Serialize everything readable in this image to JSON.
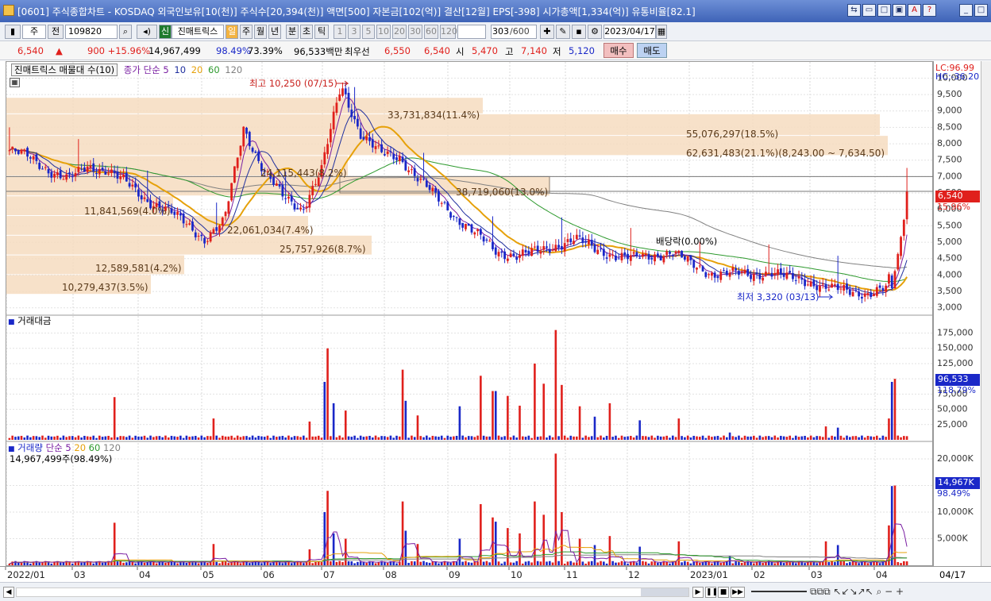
{
  "title_bar": {
    "text": "[0601] 주식종합차트 - KOSDAQ 외국인보유[10(천)] 주식수[20,394(천)] 액면[500] 자본금[102(억)] 결산[12월] EPS[-398] 시가총액[1,334(억)] 유통비율[82.1]"
  },
  "toolbar": {
    "market_select": "주",
    "prev_label": "전",
    "code": "109820",
    "source_label": "신",
    "source_name": "진매트릭스",
    "periods": [
      "일",
      "주",
      "월",
      "년",
      "분",
      "초",
      "틱"
    ],
    "intervals": [
      "1",
      "3",
      "5",
      "10",
      "20",
      "30",
      "60",
      "120"
    ],
    "count": "303",
    "count_total": "/600",
    "date": "2023/04/17"
  },
  "quote": {
    "price": "6,540",
    "change": "900 +15.96%",
    "volume": "14,967,499",
    "vol_ratio": "98.49%",
    "turnover": "73.39%",
    "amount": "96,533백만",
    "pref_label": "최우선",
    "ask": "6,550",
    "bid": "6,540",
    "open_label": "시",
    "open": "5,470",
    "high_label": "고",
    "high": "7,140",
    "low_label": "저",
    "low": "5,120",
    "buy_label": "매수",
    "sell_label": "매도"
  },
  "price_panel": {
    "legend_name": "진매트릭스 매물대 수(10)",
    "ma_label": "종가 단순 5",
    "ma_periods": [
      "10",
      "20",
      "60",
      "120"
    ],
    "lc_label": "LC:96.99",
    "hc_label": "HC:-36.20",
    "high_note": "최고 10,250 (07/15)",
    "low_note": "최저 3,320 (03/13)",
    "dividend_note": "배당락(0.00%)",
    "current_price": "6,540",
    "current_pct": "15.96%",
    "volume_profile": [
      {
        "label": "33,731,834(11.4%)"
      },
      {
        "label": "55,076,297(18.5%)"
      },
      {
        "label": "62,631,483(21.1%)(8,243.00 ~ 7,634.50)"
      },
      {
        "label": "24,115,443(8.2%)"
      },
      {
        "label": "38,719,060(13.0%)"
      },
      {
        "label": "11,841,569(4.0%)"
      },
      {
        "label": "22,061,034(7.4%)"
      },
      {
        "label": "25,757,926(8.7%)"
      },
      {
        "label": "12,589,581(4.2%)"
      },
      {
        "label": "10,279,437(3.5%)"
      }
    ]
  },
  "amount_panel": {
    "title": "거래대금",
    "current": "96,533",
    "current_pct": "118.79%"
  },
  "volume_panel": {
    "title": "거래량",
    "ma_label": "단순 5",
    "ma_periods": [
      "20",
      "60",
      "120"
    ],
    "value_label": "14,967,499주(98.49%)",
    "current": "14,967K",
    "current_pct": "98.49%"
  },
  "x_axis_labels": [
    "2022/01",
    "03",
    "04",
    "05",
    "06",
    "07",
    "08",
    "09",
    "10",
    "11",
    "12",
    "2023/01",
    "02",
    "03",
    "04"
  ],
  "x_axis_end": "04/17",
  "chart_data": {
    "type": "candlestick",
    "price_axis": [
      "10,000",
      "9,500",
      "9,000",
      "8,500",
      "8,000",
      "7,500",
      "7,000",
      "6,500",
      "6,000",
      "5,500",
      "5,000",
      "4,500",
      "4,000",
      "3,500",
      "3,000"
    ],
    "amount_axis": [
      "175,000",
      "150,000",
      "125,000",
      "100,000",
      "75,000",
      "50,000",
      "25,000"
    ],
    "volume_axis": [
      "20,000K",
      "15,000K",
      "10,000K",
      "5,000K"
    ],
    "close_approx": [
      7800,
      7600,
      7200,
      6900,
      7300,
      7200,
      6800,
      6300,
      6000,
      5600,
      5100,
      5600,
      8500,
      7200,
      6400,
      6000,
      7200,
      9800,
      8300,
      7700,
      7600,
      6900,
      6300,
      5700,
      5200,
      4700,
      4600,
      4700,
      4900,
      5100,
      4800,
      4600,
      4500,
      4600,
      4700,
      4300,
      4050,
      4050,
      4000,
      4100,
      3900,
      3800,
      3600,
      3500,
      3450,
      3600,
      6540
    ]
  },
  "colors": {
    "up": "#e0201c",
    "down": "#1a28c8",
    "ma5": "#7a1fa2",
    "ma10": "#1f2f9e",
    "ma20": "#e6a10a",
    "ma60": "#2e9a2e",
    "ma120": "#808080",
    "profile": "#f6dcc0"
  }
}
